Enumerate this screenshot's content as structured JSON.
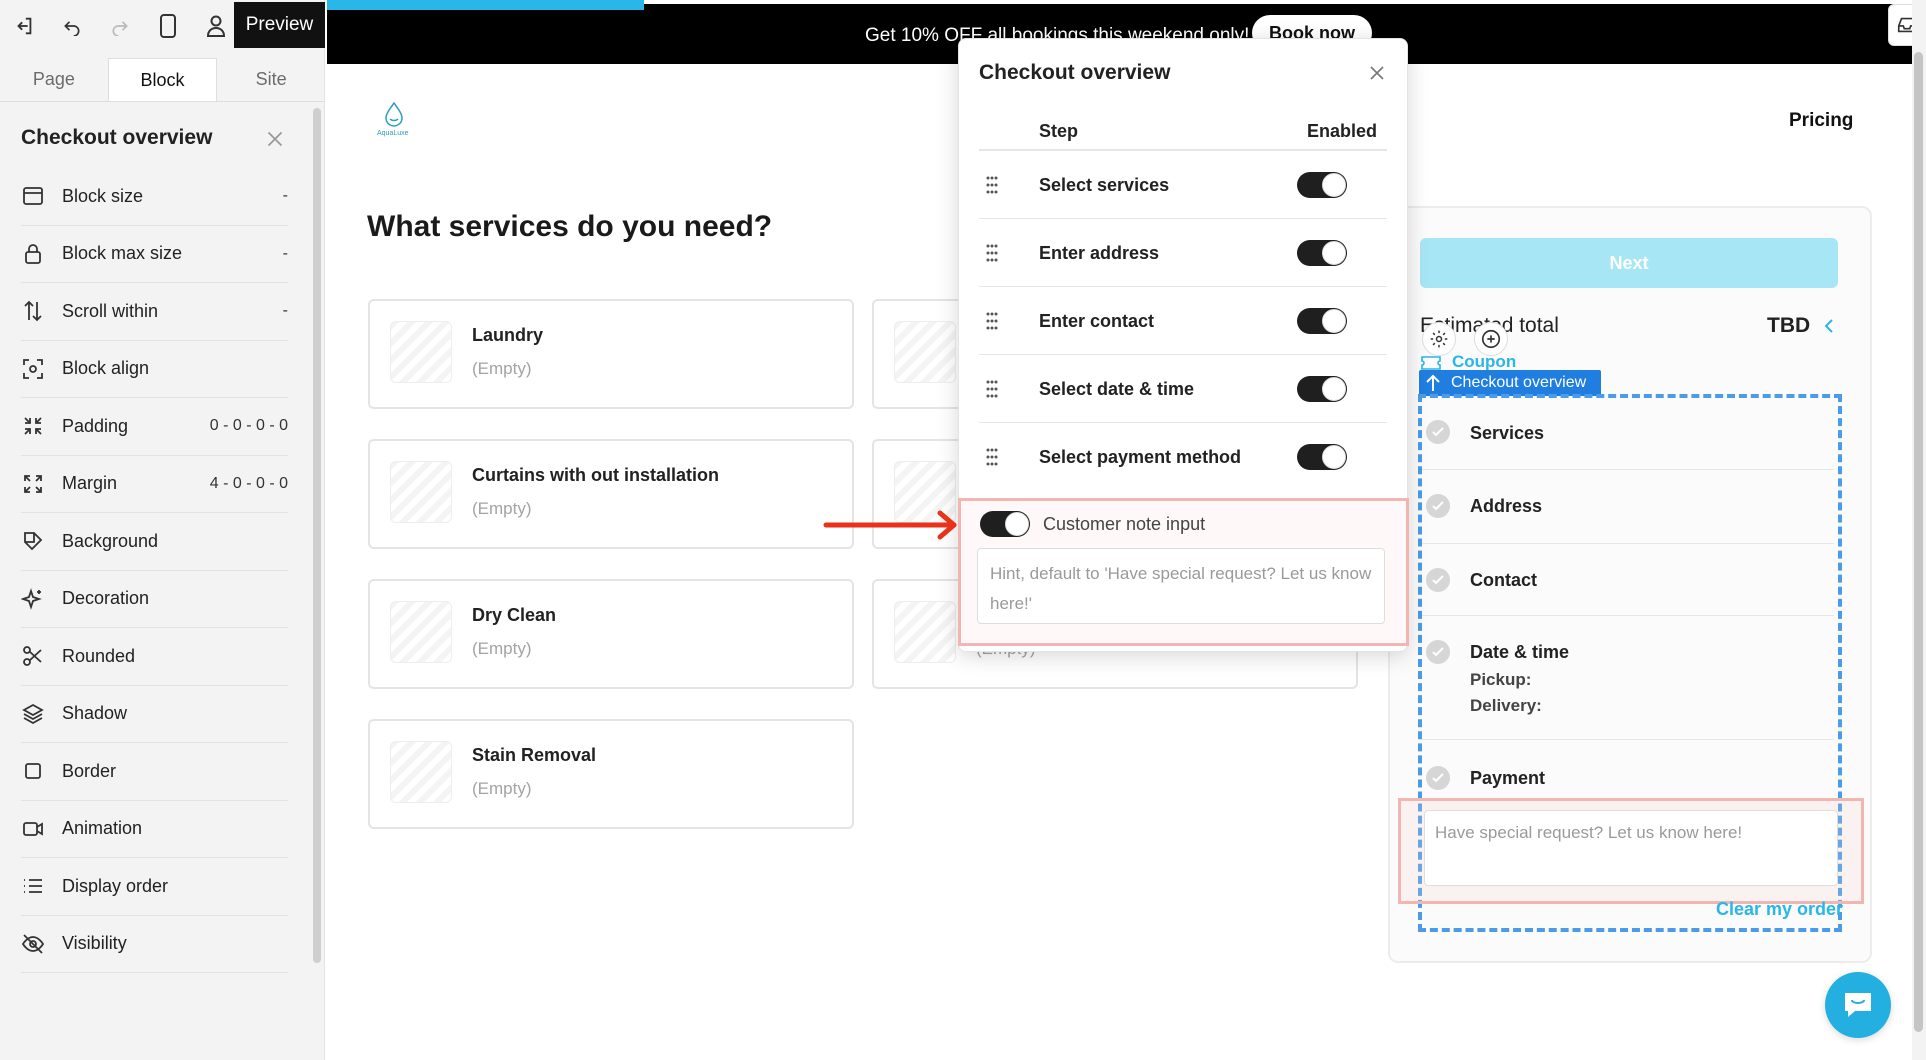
{
  "editor": {
    "toolbar": {
      "preview_label": "Preview"
    },
    "tabs": [
      "Page",
      "Block",
      "Site"
    ],
    "active_tab": "Block",
    "panel_title": "Checkout overview",
    "properties": [
      {
        "label": "Block size",
        "value": "-",
        "icon": "block-size-icon"
      },
      {
        "label": "Block max size",
        "value": "-",
        "icon": "lock-icon"
      },
      {
        "label": "Scroll within",
        "value": "-",
        "icon": "scroll-arrows-icon"
      },
      {
        "label": "Block align",
        "value": "",
        "icon": "align-target-icon"
      },
      {
        "label": "Padding",
        "value": "0 - 0 - 0 - 0",
        "icon": "padding-icon"
      },
      {
        "label": "Margin",
        "value": "4 - 0 - 0 - 0",
        "icon": "margin-icon"
      },
      {
        "label": "Background",
        "value": "",
        "icon": "background-icon"
      },
      {
        "label": "Decoration",
        "value": "",
        "icon": "sparkle-icon"
      },
      {
        "label": "Rounded",
        "value": "",
        "icon": "scissors-icon"
      },
      {
        "label": "Shadow",
        "value": "",
        "icon": "layers-icon"
      },
      {
        "label": "Border",
        "value": "",
        "icon": "square-icon"
      },
      {
        "label": "Animation",
        "value": "",
        "icon": "video-icon"
      },
      {
        "label": "Display order",
        "value": "",
        "icon": "list-icon"
      },
      {
        "label": "Visibility",
        "value": "",
        "icon": "eye-off-icon"
      }
    ]
  },
  "site": {
    "banner": {
      "text": "Get 10% OFF all bookings this weekend only!",
      "button": "Book now"
    },
    "nav": {
      "pricing": "Pricing"
    },
    "heading": "What services do you need?",
    "services": [
      {
        "name": "Laundry",
        "status": "(Empty)"
      },
      {
        "name": "Curtains with out installation",
        "status": "(Empty)"
      },
      {
        "name": "Dry Clean",
        "status": "(Empty)"
      },
      {
        "name": "Stain Removal",
        "status": "(Empty)"
      }
    ],
    "partial_card_status": "(Empty)",
    "checkout": {
      "next_label": "Next",
      "estimated_total_label": "Estimated total",
      "estimated_total_value": "TBD",
      "coupon_label": "Coupon",
      "block_tag": "Checkout overview",
      "steps": [
        "Services",
        "Address",
        "Contact",
        "Date & time",
        "Payment"
      ],
      "pickup_label": "Pickup:",
      "delivery_label": "Delivery:",
      "note_placeholder": "Have special request? Let us know here!",
      "clear_order": "Clear my order"
    }
  },
  "popover": {
    "title": "Checkout overview",
    "col_step": "Step",
    "col_enabled": "Enabled",
    "rows": [
      {
        "label": "Select services",
        "enabled": true
      },
      {
        "label": "Enter address",
        "enabled": true
      },
      {
        "label": "Enter contact",
        "enabled": true
      },
      {
        "label": "Select date & time",
        "enabled": true
      },
      {
        "label": "Select payment method",
        "enabled": true
      }
    ],
    "note_toggle_label": "Customer note input",
    "note_toggle_enabled": true,
    "note_hint_placeholder": "Hint, default to 'Have special request? Let us know here!'"
  },
  "colors": {
    "accent": "#29b6e8",
    "selection": "#1f7ee0",
    "highlight": "#f2b6b2",
    "arrow": "#e8321a"
  }
}
